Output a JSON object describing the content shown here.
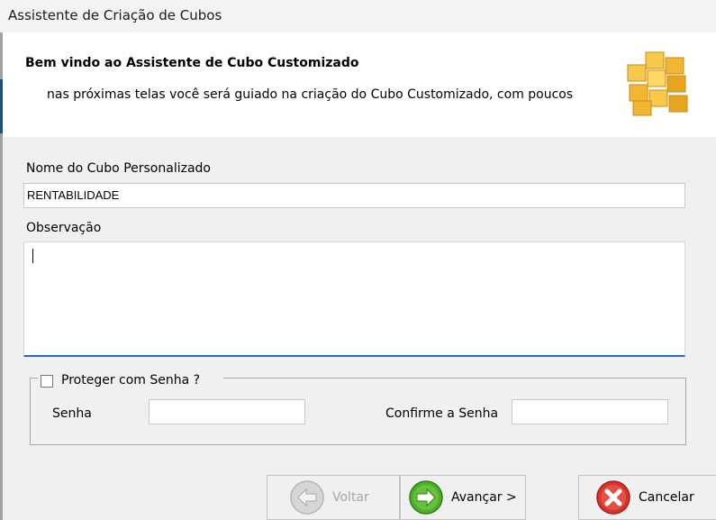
{
  "window": {
    "title": "Assistente de Criação de Cubos"
  },
  "header": {
    "title": "Bem vindo ao Assistente de Cubo Customizado",
    "subtitle": "nas próximas telas você será guiado na criação do Cubo Customizado, com poucos",
    "icon": "cube-icon"
  },
  "form": {
    "name_label": "Nome do Cubo Personalizado",
    "name_value": "RENTABILIDADE",
    "obs_label": "Observação",
    "obs_value": "",
    "protect_label": "Proteger com Senha ?",
    "protect_checked": false,
    "password_label": "Senha",
    "password_value": "",
    "confirm_label": "Confirme a Senha",
    "confirm_value": ""
  },
  "buttons": {
    "back_label": "Voltar",
    "back_icon": "arrow-left-icon",
    "next_label": "Avançar >",
    "next_icon": "arrow-right-icon",
    "cancel_label": "Cancelar",
    "cancel_icon": "close-icon"
  },
  "colors": {
    "accent": "#1f6fb8",
    "next_green": "#3a9a1c",
    "cancel_red": "#d9342b",
    "cube": "#f2b632"
  }
}
